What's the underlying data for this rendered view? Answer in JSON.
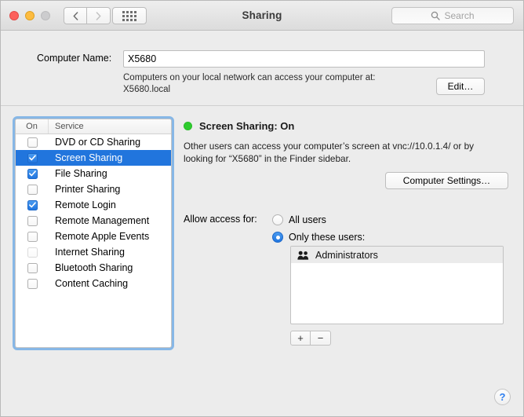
{
  "window": {
    "title": "Sharing",
    "traffic_lights": [
      "close",
      "minimize",
      "zoom"
    ]
  },
  "toolbar": {
    "back_icon": "chevron-left-icon",
    "forward_icon": "chevron-right-icon",
    "grid_icon": "show-all-grid-icon",
    "search_placeholder": "Search",
    "search_value": "",
    "search_icon": "search-icon"
  },
  "computer_name": {
    "label": "Computer Name:",
    "value": "X5680",
    "help_line1": "Computers on your local network can access your computer at:",
    "help_line2": "X5680.local",
    "edit_button": "Edit…"
  },
  "service_list": {
    "col_on": "On",
    "col_service": "Service",
    "rows": [
      {
        "name": "DVD or CD Sharing",
        "checked": false,
        "selected": false,
        "enabled": true
      },
      {
        "name": "Screen Sharing",
        "checked": true,
        "selected": true,
        "enabled": true
      },
      {
        "name": "File Sharing",
        "checked": true,
        "selected": false,
        "enabled": true
      },
      {
        "name": "Printer Sharing",
        "checked": false,
        "selected": false,
        "enabled": true
      },
      {
        "name": "Remote Login",
        "checked": true,
        "selected": false,
        "enabled": true
      },
      {
        "name": "Remote Management",
        "checked": false,
        "selected": false,
        "enabled": true
      },
      {
        "name": "Remote Apple Events",
        "checked": false,
        "selected": false,
        "enabled": true
      },
      {
        "name": "Internet Sharing",
        "checked": false,
        "selected": false,
        "enabled": false
      },
      {
        "name": "Bluetooth Sharing",
        "checked": false,
        "selected": false,
        "enabled": true
      },
      {
        "name": "Content Caching",
        "checked": false,
        "selected": false,
        "enabled": true
      }
    ]
  },
  "detail": {
    "status_dot_color": "#2ecc2e",
    "status_text": "Screen Sharing: On",
    "description": "Other users can access your computer’s screen at vnc://10.0.1.4/ or by looking for “X5680” in the Finder sidebar.",
    "computer_settings_button": "Computer Settings…"
  },
  "allow_access": {
    "label": "Allow access for:",
    "options": [
      {
        "label": "All users",
        "selected": false
      },
      {
        "label": "Only these users:",
        "selected": true
      }
    ],
    "users": [
      {
        "name": "Administrators",
        "icon": "group-users-icon"
      }
    ],
    "add_button": "+",
    "remove_button": "−"
  },
  "help": {
    "label": "?"
  },
  "colors": {
    "accent_blue": "#2175dd",
    "status_green": "#2ecc2e",
    "window_bg": "#ececec"
  }
}
